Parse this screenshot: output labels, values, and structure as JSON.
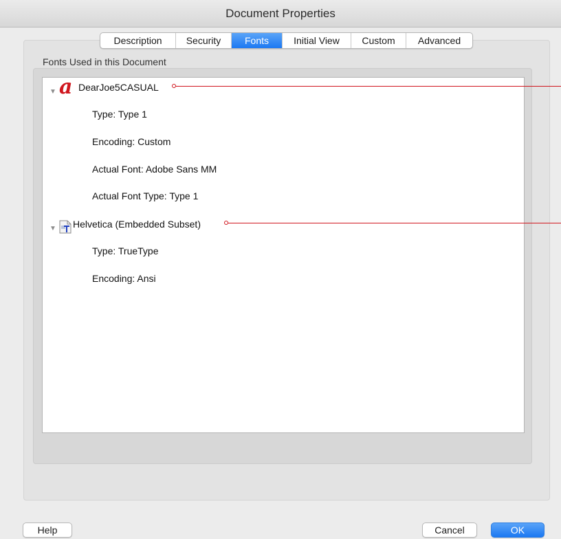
{
  "window": {
    "title": "Document Properties"
  },
  "tabs": [
    {
      "label": "Description",
      "active": false
    },
    {
      "label": "Security",
      "active": false
    },
    {
      "label": "Fonts",
      "active": true
    },
    {
      "label": "Initial View",
      "active": false
    },
    {
      "label": "Custom",
      "active": false
    },
    {
      "label": "Advanced",
      "active": false
    }
  ],
  "section": {
    "label": "Fonts Used in this Document"
  },
  "fonts": [
    {
      "name": "DearJoe5CASUAL",
      "icon": "type1-font-icon",
      "expanded": true,
      "properties": [
        "Type: Type 1",
        "Encoding: Custom",
        "Actual Font: Adobe Sans MM",
        "Actual Font Type: Type 1"
      ]
    },
    {
      "name": "Helvetica (Embedded Subset)",
      "icon": "truetype-font-icon",
      "expanded": true,
      "properties": [
        "Type: TrueType",
        "Encoding: Ansi"
      ]
    }
  ],
  "buttons": {
    "help": "Help",
    "cancel": "Cancel",
    "ok": "OK"
  },
  "colors": {
    "accent": "#1b78f2",
    "callout": "#d0141c",
    "type1_icon": "#d0181f"
  }
}
